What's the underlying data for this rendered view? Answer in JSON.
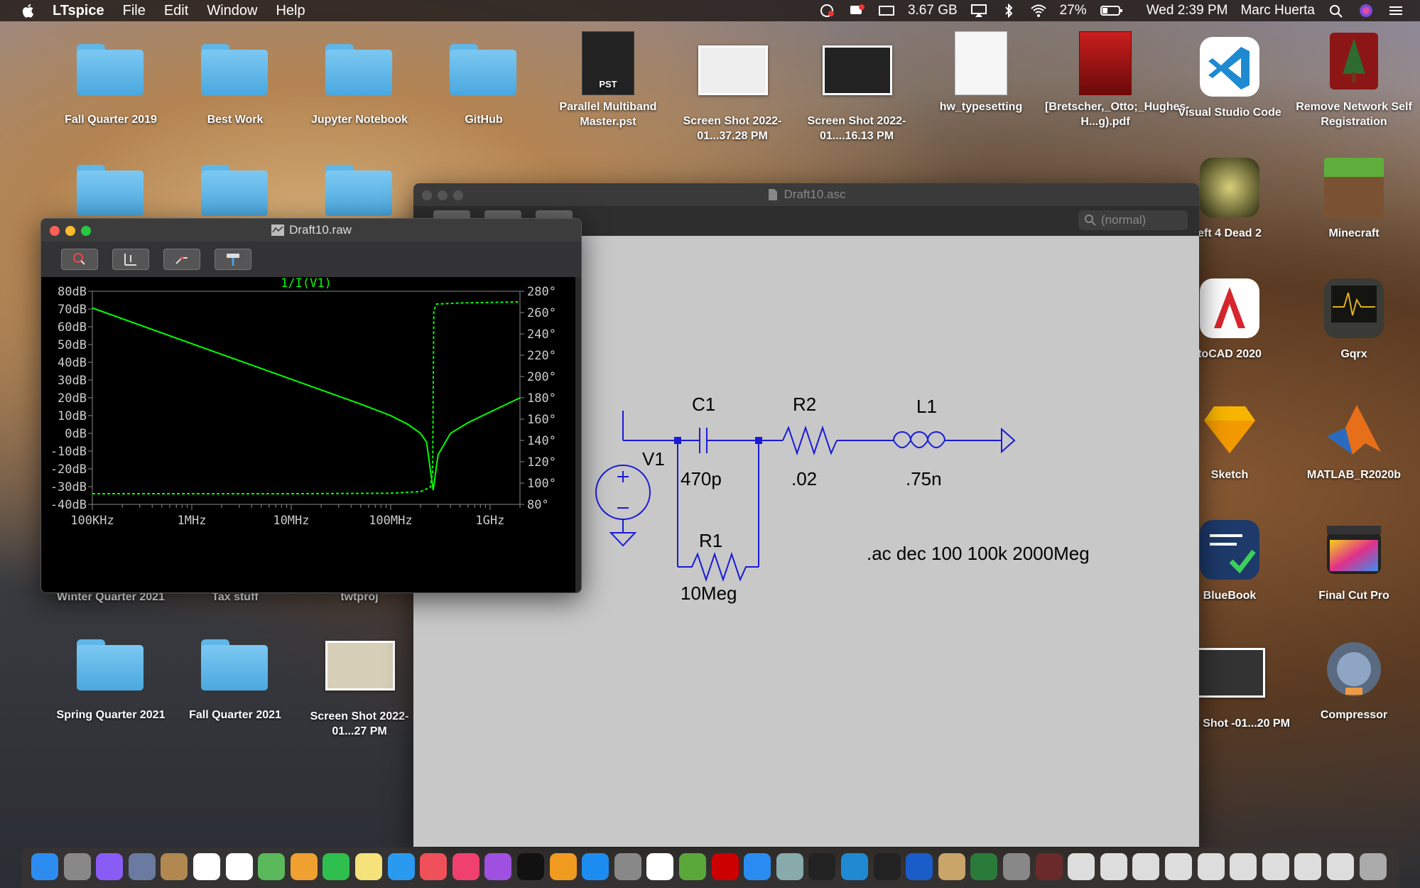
{
  "menubar": {
    "app_name": "LTspice",
    "menus": [
      "File",
      "Edit",
      "Window",
      "Help"
    ],
    "memory": "3.67 GB",
    "battery": "27%",
    "clock": "Wed 2:39 PM",
    "user": "Marc Huerta"
  },
  "desktop_icons": [
    {
      "label": "Fall Quarter 2019",
      "kind": "folder"
    },
    {
      "label": "Best Work",
      "kind": "folder"
    },
    {
      "label": "Jupyter Notebook",
      "kind": "folder"
    },
    {
      "label": "GitHub",
      "kind": "folder"
    },
    {
      "label": "Parallel Multiband Master.pst",
      "kind": "pst",
      "badge": "PST"
    },
    {
      "label": "Screen Shot 2022-01...37.28 PM",
      "kind": "shot"
    },
    {
      "label": "Screen Shot 2022-01....16.13 PM",
      "kind": "shot"
    },
    {
      "label": "hw_typesetting",
      "kind": "doc"
    },
    {
      "label": "[Bretscher,_Otto;_Hughes-H...g).pdf",
      "kind": "pdf"
    },
    {
      "label": "Visual Studio Code",
      "kind": "vscode"
    },
    {
      "label": "Remove Network Self Registration",
      "kind": "stanford"
    },
    {
      "label": "eft 4 Dead 2",
      "kind": "l4d"
    },
    {
      "label": "Minecraft",
      "kind": "minecraft"
    },
    {
      "label": "toCAD 2020",
      "kind": "autocad"
    },
    {
      "label": "Gqrx",
      "kind": "gqrx"
    },
    {
      "label": "Sketch",
      "kind": "sketch"
    },
    {
      "label": "MATLAB_R2020b",
      "kind": "matlab"
    },
    {
      "label": "BlueBook",
      "kind": "bluebook"
    },
    {
      "label": "Final Cut Pro",
      "kind": "fcp"
    },
    {
      "label": "creen Shot -01...20 PM",
      "kind": "shot"
    },
    {
      "label": "Compressor",
      "kind": "compressor"
    },
    {
      "label": "Winter Quarter 2021",
      "kind": "folder"
    },
    {
      "label": "Tax stuff",
      "kind": "folder"
    },
    {
      "label": "twtproj",
      "kind": "folder"
    },
    {
      "label": "Spring Quarter 2021",
      "kind": "folder"
    },
    {
      "label": "Fall Quarter 2021",
      "kind": "folder"
    },
    {
      "label": "Screen Shot 2022-01...27 PM",
      "kind": "shot"
    }
  ],
  "schematic_window": {
    "title": "Draft10.asc",
    "search_placeholder": "(normal)",
    "components": {
      "v1": "V1",
      "c1": "C1",
      "c1_value": "470p",
      "r2": "R2",
      "r2_value": ".02",
      "l1": "L1",
      "l1_value": ".75n",
      "r1": "R1",
      "r1_value": "10Meg"
    },
    "directive": ".ac dec 100 100k 2000Meg"
  },
  "plot_window": {
    "title": "Draft10.raw",
    "trace_label": "1/I(V1)",
    "trace_color": "#00ff00",
    "background": "#000000"
  },
  "chart_data": {
    "type": "line",
    "title": "1/I(V1)",
    "x_scale": "log",
    "xlim": [
      100000,
      2000000000
    ],
    "x_ticks": [
      "100KHz",
      "1MHz",
      "10MHz",
      "100MHz",
      "1GHz"
    ],
    "ylim_left": [
      -40,
      80
    ],
    "y_ticks_left": [
      "80dB",
      "70dB",
      "60dB",
      "50dB",
      "40dB",
      "30dB",
      "20dB",
      "10dB",
      "0dB",
      "-10dB",
      "-20dB",
      "-30dB",
      "-40dB"
    ],
    "ylim_right": [
      80,
      280
    ],
    "y_ticks_right": [
      "280°",
      "260°",
      "240°",
      "220°",
      "200°",
      "180°",
      "160°",
      "140°",
      "120°",
      "100°",
      "80°"
    ],
    "series": [
      {
        "name": "1/I(V1)",
        "axis": "left",
        "style": "solid",
        "x": [
          100000,
          1000000,
          10000000,
          50000000,
          100000000,
          150000000,
          200000000,
          230000000,
          268000000,
          300000000,
          400000000,
          600000000,
          1000000000,
          2000000000
        ],
        "y": [
          70.6,
          50.5,
          30.5,
          16.5,
          10,
          5,
          0,
          -5,
          -32,
          -12,
          0,
          6,
          12,
          20
        ]
      },
      {
        "axis": "right",
        "style": "dashed",
        "x": [
          100000,
          10000000,
          100000000,
          200000000,
          250000000,
          265000000,
          268000000,
          272000000,
          290000000,
          500000000,
          2000000000
        ],
        "y": [
          90,
          90,
          90.5,
          92,
          96,
          110,
          180,
          262,
          268,
          269,
          270
        ]
      }
    ]
  },
  "dock": {
    "icons": [
      "finder",
      "launchpad",
      "siri",
      "preview",
      "contacts",
      "calendar",
      "reminders",
      "maps",
      "photos",
      "facetime",
      "notes",
      "messages",
      "news",
      "music",
      "podcasts",
      "tv",
      "books",
      "appstore",
      "system-preferences",
      "chrome",
      "minecraft",
      "autocad",
      "safari",
      "image-capture",
      "activity-monitor",
      "vscode",
      "terminal",
      "kicad",
      "pcb-editor",
      "pcb-layout",
      "calculator",
      "ltspice",
      "window-1",
      "window-2",
      "window-3",
      "window-4",
      "window-5",
      "window-6",
      "window-7",
      "window-8",
      "window-9",
      "trash"
    ]
  }
}
